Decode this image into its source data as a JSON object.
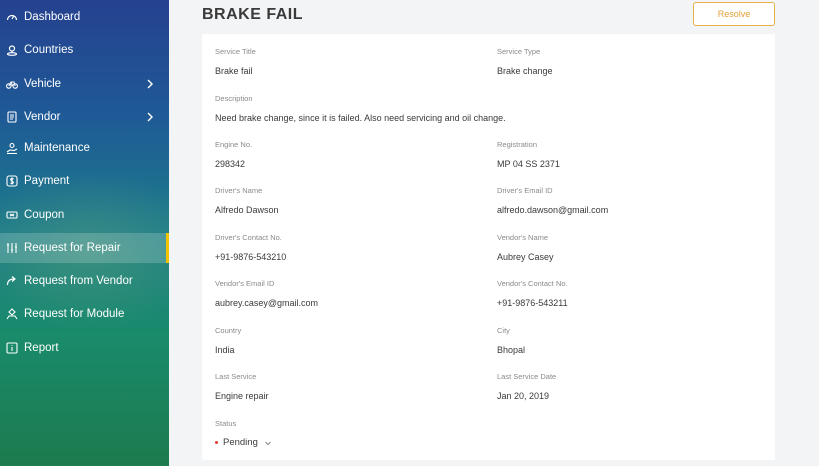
{
  "sidebar": {
    "items": [
      {
        "label": "Dashboard",
        "icon": "dashboard-gauge-icon",
        "has_submenu": false
      },
      {
        "label": "Countries",
        "icon": "location-pin-icon",
        "has_submenu": false
      },
      {
        "label": "Vehicle",
        "icon": "bicycle-icon",
        "has_submenu": true
      },
      {
        "label": "Vendor",
        "icon": "document-list-icon",
        "has_submenu": true
      },
      {
        "label": "Maintenance",
        "icon": "hand-service-icon",
        "has_submenu": false
      },
      {
        "label": "Payment",
        "icon": "dollar-icon",
        "has_submenu": false
      },
      {
        "label": "Coupon",
        "icon": "coupon-ticket-icon",
        "has_submenu": false
      },
      {
        "label": "Request for Repair",
        "icon": "tools-icon",
        "has_submenu": false,
        "active": true
      },
      {
        "label": "Request from Vendor",
        "icon": "forward-arrow-icon",
        "has_submenu": false
      },
      {
        "label": "Request for Module",
        "icon": "module-hand-icon",
        "has_submenu": false
      },
      {
        "label": "Report",
        "icon": "info-report-icon",
        "has_submenu": false
      }
    ],
    "active_indicator_color": "#f2c300"
  },
  "header": {
    "title": "BRAKE FAIL",
    "resolve_label": "Resolve",
    "accent_color": "#e0a13a"
  },
  "details": {
    "service_title": {
      "label": "Service Title",
      "value": "Brake fail"
    },
    "service_type": {
      "label": "Service Type",
      "value": "Brake change"
    },
    "description": {
      "label": "Description",
      "value": "Need brake change, since it is failed. Also need servicing and oil change."
    },
    "engine_no": {
      "label": "Engine No.",
      "value": "298342"
    },
    "registration": {
      "label": "Registration",
      "value": "MP 04 SS 2371"
    },
    "driver_name": {
      "label": "Driver's Name",
      "value": "Alfredo Dawson"
    },
    "driver_email": {
      "label": "Driver's Email ID",
      "value": "alfredo.dawson@gmail.com"
    },
    "driver_contact": {
      "label": "Driver's Contact No.",
      "value": "+91-9876-543210"
    },
    "vendor_name": {
      "label": "Vendor's Name",
      "value": "Aubrey Casey"
    },
    "vendor_email": {
      "label": "Vendor's Email ID",
      "value": "aubrey.casey@gmail.com"
    },
    "vendor_contact": {
      "label": "Vendor's Contact No.",
      "value": "+91-9876-543211"
    },
    "country": {
      "label": "Country",
      "value": "India"
    },
    "city": {
      "label": "City",
      "value": "Bhopal"
    },
    "last_service": {
      "label": "Last Service",
      "value": "Engine repair"
    },
    "last_service_date": {
      "label": "Last Service Date",
      "value": "Jan 20, 2019"
    },
    "status": {
      "label": "Status",
      "value": "Pending",
      "dot_color": "#e53935"
    }
  }
}
